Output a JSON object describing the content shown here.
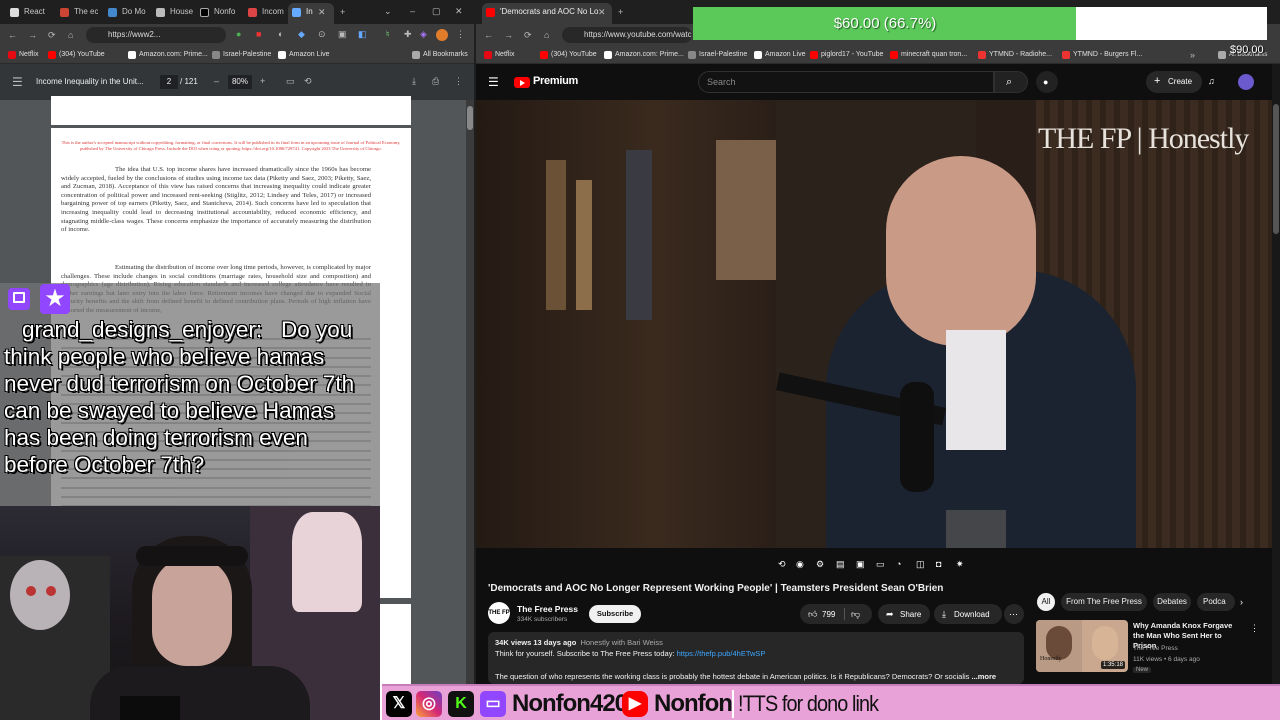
{
  "left_browser": {
    "tabs": [
      "React",
      "The ec",
      "Do Mo",
      "House",
      "Nonfo",
      "Incom",
      "In"
    ],
    "url": "https://www2...",
    "bookmarks": [
      "Netflix",
      "(304) YouTube",
      "Amazon.com: Prime...",
      "Israel-Palestine",
      "Amazon Live",
      "All Bookmarks"
    ],
    "pdf": {
      "title": "Income Inequality in the Unit...",
      "page_current": "2",
      "page_total": "/ 121",
      "zoom": "80%",
      "red_notice": "This is the author's accepted manuscript without copyediting, formatting, or final corrections. It will be published in its final form in an upcoming issue of Journal of Political Economy, published by The University of Chicago Press. Include the DOI when citing or quoting: https://doi.org/10.1086/728741. Copyright 2023 The University of Chicago.",
      "para1": "The idea that U.S. top income shares have increased dramatically since the 1960s has become widely accepted, fueled by the conclusions of studies using income tax data (Piketty and Saez, 2003; Piketty, Saez, and Zucman, 2018). Acceptance of this view has raised concerns that increasing inequality could indicate greater concentration of political power and increased rent-seeking (Stiglitz, 2012; Lindsey and Teles, 2017) or increased bargaining power of top earners (Piketty, Saez, and Stantcheva, 2014). Such concerns have led to speculation that increasing inequality could lead to decreasing institutional accountability, reduced economic efficiency, and stagnating middle-class wages. These concerns emphasize the importance of accurately measuring the distribution of income.",
      "para2": "Estimating the distribution of income over long time periods, however, is complicated by major challenges. These include changes in social conditions (marriage rates, household size and composition) and demographics (age distribution). Rising education standards and increased college attendance have resulted in higher earnings but later entry into the labor force. Retirement incomes have changed due to expanded Social Security benefits and the shift from defined benefit to defined contribution plans. Periods of high inflation have distorted the measurement of income,"
    }
  },
  "chat": {
    "username": "grand_designs_enjoyer:",
    "message": "Do you think people who believe hamas never dud terrorism on October 7th can be swayed to believe Hamas has been doing terrorism even before October 7th?"
  },
  "right_browser": {
    "tab_title": "'Democrats and AOC No Lo",
    "url": "https://www.youtube.com/watch",
    "bookmarks": [
      "Netflix",
      "(304) YouTube",
      "Amazon.com: Prime...",
      "Israel-Palestine",
      "Amazon Live",
      "piglord17 - YouTube",
      "minecraft quan tron...",
      "YTMND - Radiohe...",
      "YTMND - Burgers Fl...",
      "All Bookmarks"
    ],
    "youtube": {
      "logo": "Premium",
      "search_placeholder": "Search",
      "create": "Create",
      "watermark": "THE FP | Honestly",
      "video_title": "'Democrats and AOC No Longer Represent Working People' | Teamsters President Sean O'Brien",
      "channel": "The Free Press",
      "subs": "334K subscribers",
      "subscribe": "Subscribe",
      "likes": "799",
      "share": "Share",
      "download": "Download",
      "views_date": "34K views  13 days ago",
      "hashtags": "Honestly with Bari Weiss",
      "desc1": "Think for yourself. Subscribe to The Free Press today:",
      "desc_link": "https://thefp.pub/4hETwSP",
      "desc2": "The question of who represents the working class is probably the hottest debate in American politics. Is it Republicans? Democrats? Or socialis",
      "more": "...more",
      "chips": [
        "All",
        "From The Free Press",
        "Debates",
        "Podca"
      ],
      "rec": {
        "title": "Why Amanda Knox Forgave the Man Who Sent Her to Prison",
        "channel": "The Free Press",
        "meta": "11K views • 6 days ago",
        "badge": "New",
        "duration": "1:35:18"
      }
    }
  },
  "donation": {
    "text": "$60.00 (66.7%)",
    "goal": "$90.00",
    "progress_fraction": 0.667
  },
  "socials": {
    "handle1": "Nonfon420",
    "handle2": "Nonfon",
    "tts": "!TTS for dono link"
  },
  "colors": {
    "youtube_red": "#ff0000",
    "twitch_purple": "#9146ff",
    "kick_green": "#53fc18",
    "donation_green": "#5bc85a",
    "social_pink": "#e8a2d8"
  }
}
